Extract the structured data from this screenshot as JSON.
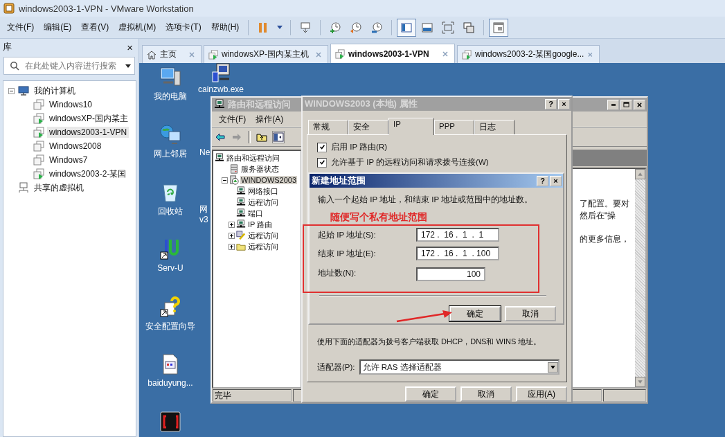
{
  "window": {
    "title": "windows2003-1-VPN - VMware Workstation"
  },
  "menu": [
    "文件(F)",
    "编辑(E)",
    "查看(V)",
    "虚拟机(M)",
    "选项卡(T)",
    "帮助(H)"
  ],
  "toolbar": [
    {
      "kind": "pause",
      "pressed": false
    },
    {
      "kind": "caret",
      "pressed": false
    },
    {
      "kind": "send-keys",
      "pressed": false
    },
    {
      "kind": "snapshot-take",
      "pressed": false
    },
    {
      "kind": "snapshot-revert",
      "pressed": false
    },
    {
      "kind": "snapshot-manager",
      "pressed": false
    },
    {
      "kind": "view-sidebar",
      "pressed": true
    },
    {
      "kind": "view-console",
      "pressed": false
    },
    {
      "kind": "fullscreen",
      "pressed": false
    },
    {
      "kind": "unity",
      "pressed": false
    },
    {
      "kind": "thumbnails",
      "pressed": true
    }
  ],
  "library": {
    "title": "库",
    "close": "×",
    "search": {
      "placeholder": "在此处键入内容进行搜索"
    },
    "tree": [
      {
        "label": "我的计算机",
        "kind": "computer",
        "expanded": true,
        "children": [
          {
            "label": "Windows10",
            "kind": "vm",
            "running": false,
            "selected": false
          },
          {
            "label": "windowsXP-国内某主",
            "kind": "vm",
            "running": true,
            "selected": false
          },
          {
            "label": "windows2003-1-VPN",
            "kind": "vm",
            "running": true,
            "selected": true
          },
          {
            "label": "Windows2008",
            "kind": "vm",
            "running": false,
            "selected": false
          },
          {
            "label": "Windows7",
            "kind": "vm",
            "running": false,
            "selected": false
          },
          {
            "label": "windows2003-2-某国",
            "kind": "vm",
            "running": true,
            "selected": false
          }
        ]
      },
      {
        "label": "共享的虚拟机",
        "kind": "shared"
      }
    ]
  },
  "tabs": [
    {
      "label": "主页",
      "kind": "home",
      "selected": false
    },
    {
      "label": "windowsXP-国内某主机",
      "kind": "vm",
      "selected": false
    },
    {
      "label": "windows2003-1-VPN",
      "kind": "vm",
      "selected": true
    },
    {
      "label": "windows2003-2-某国google...",
      "kind": "vm",
      "selected": false
    }
  ],
  "desktop": {
    "icons": [
      {
        "label": "我的电脑",
        "kind": "computer"
      },
      {
        "label": "网上邻居",
        "kind": "network"
      },
      {
        "label": "回收站",
        "kind": "recycle"
      },
      {
        "label": "Serv-U",
        "kind": "servu"
      },
      {
        "label": "安全配置向导",
        "kind": "wizard"
      },
      {
        "label": "baiduyung...",
        "kind": "document"
      },
      {
        "kind": "cain"
      }
    ],
    "icons_second_column": [
      {
        "label": "cainzwb.exe",
        "kind": "program"
      },
      {
        "label": "Ne",
        "kind": "none"
      },
      {
        "label": "网",
        "kind": "none"
      },
      {
        "label": "v3",
        "kind": "none"
      }
    ]
  },
  "mmc": {
    "title": "路由和远程访问",
    "menu": [
      "文件(F)",
      "操作(A)"
    ],
    "tree": [
      {
        "label": "路由和远程访问",
        "kind": "console",
        "children": [
          {
            "label": "服务器状态",
            "kind": "server-status"
          },
          {
            "label": "WINDOWS2003",
            "kind": "server",
            "expanded": true,
            "selected": true,
            "children": [
              {
                "label": "网络接口",
                "kind": "console"
              },
              {
                "label": "远程访问",
                "kind": "console"
              },
              {
                "label": "端口",
                "kind": "console"
              },
              {
                "label": "IP 路由",
                "kind": "console",
                "expanded": false
              },
              {
                "label": "远程访问",
                "kind": "policy",
                "expanded": false
              },
              {
                "label": "远程访问",
                "kind": "folder",
                "expanded": false
              }
            ]
          }
        ]
      }
    ],
    "detail_lines": [
      "了配置。要对",
      "然后在“操",
      "的更多信息，"
    ],
    "status": "完毕"
  },
  "properties": {
    "title": "WINDOWS2003 (本地) 属性",
    "help": "?",
    "close": "×",
    "tabs": [
      {
        "label": "常规",
        "selected": false
      },
      {
        "label": "安全",
        "selected": false
      },
      {
        "label": "IP",
        "selected": true
      },
      {
        "label": "PPP",
        "selected": false
      },
      {
        "label": "日志",
        "selected": false
      }
    ],
    "options": [
      {
        "label": "启用 IP 路由(R)",
        "checked": true
      },
      {
        "label": "允许基于 IP 的远程访问和请求拨号连接(W)",
        "checked": true
      }
    ],
    "adapter_note": "使用下面的适配器为拨号客户端获取 DHCP，DNS和 WINS 地址。",
    "adapter_label": "适配器(P):",
    "adapter_value": "允许 RAS 选择适配器",
    "buttons": [
      "确定",
      "取消",
      "应用(A)"
    ]
  },
  "range_dialog": {
    "title": "新建地址范围",
    "help": "?",
    "close": "×",
    "instruction": "输入一个起始 IP 地址，和结束 IP 地址或范围中的地址数。",
    "fields": [
      {
        "label": "起始 IP 地址(S):",
        "value": "172 .  16 .  1  .  1",
        "kind": "ip"
      },
      {
        "label": "结束 IP 地址(E):",
        "value": "172 .  16 .  1  . 100",
        "kind": "ip"
      },
      {
        "label": "地址数(N):",
        "value": "100",
        "kind": "number"
      }
    ],
    "buttons": [
      {
        "label": "确定",
        "default": true
      },
      {
        "label": "取消",
        "default": false
      }
    ]
  },
  "annotation": {
    "text": "随便写个私有地址范围"
  }
}
